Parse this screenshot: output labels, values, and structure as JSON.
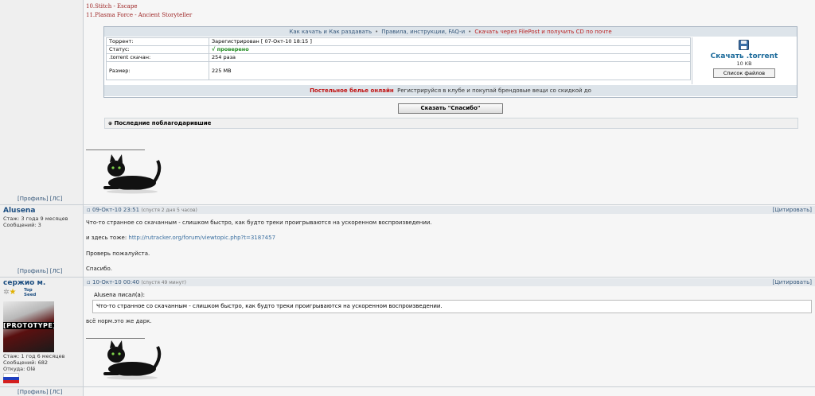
{
  "tracklist": [
    {
      "label": "10.Stitch - Escape"
    },
    {
      "label": "11.Plasma Force - Ancient Storyteller"
    }
  ],
  "torrent": {
    "header_links": [
      "Как качать и Как раздавать",
      "Правила, инструкции, FAQ-и",
      "Скачать через FilePost и получить CD по почте"
    ],
    "rows": [
      {
        "key": "Торрент:",
        "value": "Зарегистрирован   [ 07-Окт-10 18:15 ]"
      },
      {
        "key": "Статус:",
        "value": "√ проверено"
      },
      {
        "key": ".torrent скачан:",
        "value": "254 раза"
      },
      {
        "key": "Размер:",
        "value": "225 MB"
      }
    ],
    "download_label": "Скачать .torrent",
    "download_size": "10 KB",
    "files_button": "Список файлов",
    "promo_bold": "Постельное белье онлайн",
    "promo_text": "Регистрируйся в клубе и покупай брендовые вещи со скидкой до"
  },
  "thanks_button": "Сказать \"Спасибо\"",
  "last_thanked": "Последние поблагодарившие",
  "profile_links": "[Профиль]  [ЛС]",
  "posts": [
    {
      "author": "Alusena",
      "meta": [
        "Стаж: 3 года 9 месяцев",
        "Сообщений: 3"
      ],
      "date": "09-Окт-10 23:51",
      "ago": "(спустя 2 дня 5 часов)",
      "quote_label": "[Цитировать]",
      "lines": [
        "Что-то странное со скачанным - слишком быстро, как будто треки проигрываются на ускоренном воспроизведении.",
        "и здесь тоже:",
        "Проверь пожалуйста.",
        "Спасибо."
      ],
      "link": "http://rutracker.org/forum/viewtopic.php?t=3187457"
    },
    {
      "author": "сержио м.",
      "badge": "Top Seed",
      "meta": [
        "Стаж: 1 год 6 месяцев",
        "Сообщений: 682",
        "Откуда: Olё"
      ],
      "date": "10-Окт-10 00:40",
      "ago": "(спустя 49 минут)",
      "quote_label": "[Цитировать]",
      "quote_author": "Alusena писал(а):",
      "quote_text": "Что-то странное со скачанным - слишком быстро, как будто треки проигрываются на ускоренном воспроизведении.",
      "reply": "всё норм.это же дарк."
    }
  ],
  "avatar_text": "[PROTOTYPE]",
  "colors": {
    "accent": "#1b4d80",
    "link": "#35577a",
    "alert": "#c01010",
    "ok": "#1f8a1f"
  }
}
